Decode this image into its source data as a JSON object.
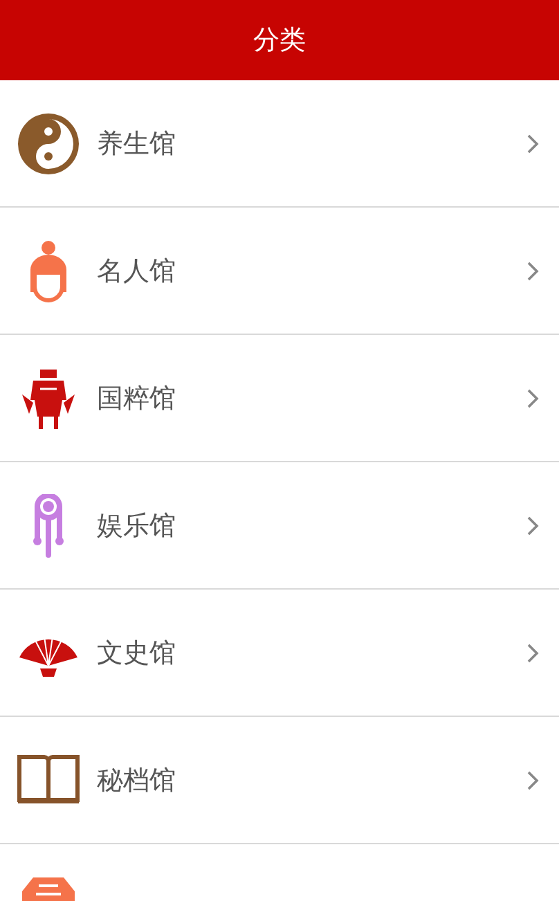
{
  "header": {
    "title": "分类"
  },
  "categories": [
    {
      "kind": "full",
      "label": "养生馆"
    },
    {
      "kind": "full",
      "label": "名人馆"
    },
    {
      "kind": "full",
      "label": "国粹馆"
    },
    {
      "kind": "full",
      "label": "娱乐馆"
    },
    {
      "kind": "full",
      "label": "文史馆"
    },
    {
      "kind": "full",
      "label": "秘档馆"
    },
    {
      "kind": "cut"
    }
  ]
}
